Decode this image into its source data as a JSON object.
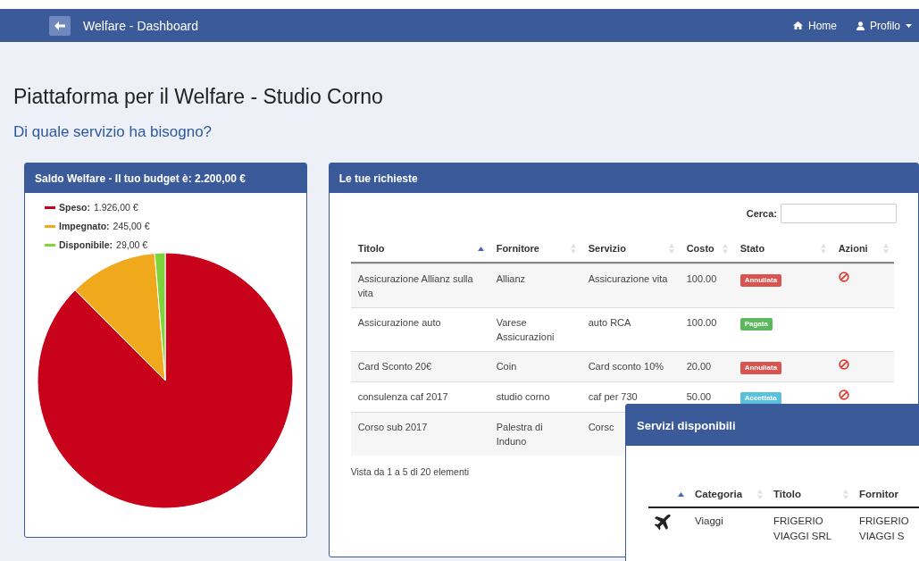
{
  "navbar": {
    "title": "Welfare - Dashboard",
    "links": [
      {
        "kind": "home",
        "label": "Home"
      },
      {
        "kind": "profile",
        "label": "Profilo"
      }
    ]
  },
  "heading": "Piattaforma per il Welfare - Studio Corno",
  "subheading": "Di quale servizio ha bisogno?",
  "budget_panel": {
    "title": "Saldo Welfare - Il tuo budget è: 2.200,00 €",
    "legend": [
      {
        "label": "Speso:",
        "value": "1.926,00 €",
        "color": "#c9021c"
      },
      {
        "label": "Impegnato:",
        "value": "245,00 €",
        "color": "#f0a81c"
      },
      {
        "label": "Disponibile:",
        "value": "29,00 €",
        "color": "#7dd43a"
      }
    ],
    "chart_data": {
      "type": "pie",
      "values": [
        87.54,
        11.14,
        1.32
      ]
    }
  },
  "requests_panel": {
    "title": "Le tue richieste",
    "search": {
      "label": "Cerca:"
    },
    "columns": [
      {
        "label": "Titolo",
        "sorted": true
      },
      {
        "label": "Fornitore",
        "sorted": false
      },
      {
        "label": "Servizio",
        "sorted": false
      },
      {
        "label": "Costo",
        "sorted": false
      },
      {
        "label": "Stato",
        "sorted": false
      },
      {
        "label": "Azioni",
        "sorted": false
      }
    ],
    "rows": [
      {
        "title": "Assicurazione Allianz sulla vita",
        "supplier": "Allianz",
        "service": "Assicurazione vita",
        "cost": "100.00",
        "status": "Annullata",
        "color": "#d9534f",
        "cancel": true
      },
      {
        "title": "Assicurazione auto",
        "supplier": "Varese Assicurazioni",
        "service": "auto RCA",
        "cost": "100.00",
        "status": "Pagata",
        "color": "#5cb85c",
        "cancel": false
      },
      {
        "title": "Card Sconto 20€",
        "supplier": "Coin",
        "service": "Card sconto 10%",
        "cost": "20.00",
        "status": "Annullata",
        "color": "#d9534f",
        "cancel": true
      },
      {
        "title": "consulenza caf 2017",
        "supplier": "studio corno",
        "service": "caf per 730",
        "cost": "50.00",
        "status": "Accettata",
        "color": "#5bc0de",
        "cancel": true
      },
      {
        "title": "Corso sub 2017",
        "supplier": "Palestra di Induno",
        "service": "Corsc"
      }
    ],
    "footer": "Vista da 1 a 5 di 20 elementi"
  },
  "services_panel": {
    "title": "Servizi disponibili",
    "columns": [
      {
        "sorted": true
      },
      {
        "label": "Categoria",
        "sorted": false
      },
      {
        "label": "Titolo",
        "sorted": false
      },
      {
        "label": "Fornitor"
      }
    ],
    "rows": [
      {
        "kind": "travel",
        "category": "Viaggi",
        "title": "FRIGERIO VIAGGI SRL",
        "supplier": "FRIGERIO VIAGGI S"
      }
    ]
  }
}
